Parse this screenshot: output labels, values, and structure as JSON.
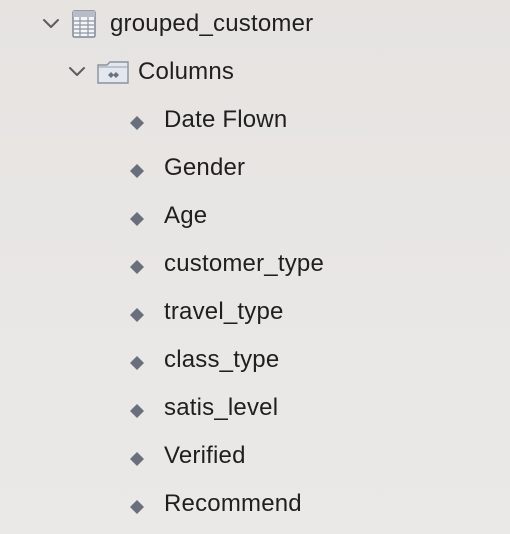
{
  "tree": {
    "table": {
      "label": "grouped_customer",
      "icon": "table-icon",
      "expanded": true
    },
    "folder": {
      "label": "Columns",
      "icon": "folder-icon",
      "expanded": true
    },
    "columns": [
      {
        "label": "Date Flown",
        "icon": "diamond-column-icon"
      },
      {
        "label": "Gender",
        "icon": "diamond-column-icon"
      },
      {
        "label": "Age",
        "icon": "diamond-column-icon"
      },
      {
        "label": "customer_type",
        "icon": "diamond-column-icon"
      },
      {
        "label": "travel_type",
        "icon": "diamond-column-icon"
      },
      {
        "label": "class_type",
        "icon": "diamond-column-icon"
      },
      {
        "label": "satis_level",
        "icon": "diamond-column-icon"
      },
      {
        "label": "Verified",
        "icon": "diamond-column-icon"
      },
      {
        "label": "Recommend",
        "icon": "diamond-column-icon"
      }
    ]
  },
  "colors": {
    "background": "#e8e6e4",
    "text": "#1f1f1f",
    "chevron": "#5c5c5c",
    "icon_stroke": "#7f8694",
    "diamond": "#69707b"
  }
}
